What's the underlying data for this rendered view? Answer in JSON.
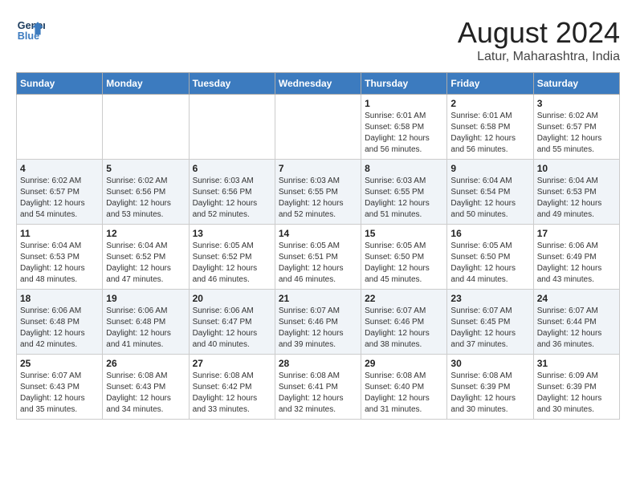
{
  "header": {
    "logo_line1": "General",
    "logo_line2": "Blue",
    "month_year": "August 2024",
    "location": "Latur, Maharashtra, India"
  },
  "days_of_week": [
    "Sunday",
    "Monday",
    "Tuesday",
    "Wednesday",
    "Thursday",
    "Friday",
    "Saturday"
  ],
  "weeks": [
    [
      {
        "day": "",
        "info": ""
      },
      {
        "day": "",
        "info": ""
      },
      {
        "day": "",
        "info": ""
      },
      {
        "day": "",
        "info": ""
      },
      {
        "day": "1",
        "info": "Sunrise: 6:01 AM\nSunset: 6:58 PM\nDaylight: 12 hours\nand 56 minutes."
      },
      {
        "day": "2",
        "info": "Sunrise: 6:01 AM\nSunset: 6:58 PM\nDaylight: 12 hours\nand 56 minutes."
      },
      {
        "day": "3",
        "info": "Sunrise: 6:02 AM\nSunset: 6:57 PM\nDaylight: 12 hours\nand 55 minutes."
      }
    ],
    [
      {
        "day": "4",
        "info": "Sunrise: 6:02 AM\nSunset: 6:57 PM\nDaylight: 12 hours\nand 54 minutes."
      },
      {
        "day": "5",
        "info": "Sunrise: 6:02 AM\nSunset: 6:56 PM\nDaylight: 12 hours\nand 53 minutes."
      },
      {
        "day": "6",
        "info": "Sunrise: 6:03 AM\nSunset: 6:56 PM\nDaylight: 12 hours\nand 52 minutes."
      },
      {
        "day": "7",
        "info": "Sunrise: 6:03 AM\nSunset: 6:55 PM\nDaylight: 12 hours\nand 52 minutes."
      },
      {
        "day": "8",
        "info": "Sunrise: 6:03 AM\nSunset: 6:55 PM\nDaylight: 12 hours\nand 51 minutes."
      },
      {
        "day": "9",
        "info": "Sunrise: 6:04 AM\nSunset: 6:54 PM\nDaylight: 12 hours\nand 50 minutes."
      },
      {
        "day": "10",
        "info": "Sunrise: 6:04 AM\nSunset: 6:53 PM\nDaylight: 12 hours\nand 49 minutes."
      }
    ],
    [
      {
        "day": "11",
        "info": "Sunrise: 6:04 AM\nSunset: 6:53 PM\nDaylight: 12 hours\nand 48 minutes."
      },
      {
        "day": "12",
        "info": "Sunrise: 6:04 AM\nSunset: 6:52 PM\nDaylight: 12 hours\nand 47 minutes."
      },
      {
        "day": "13",
        "info": "Sunrise: 6:05 AM\nSunset: 6:52 PM\nDaylight: 12 hours\nand 46 minutes."
      },
      {
        "day": "14",
        "info": "Sunrise: 6:05 AM\nSunset: 6:51 PM\nDaylight: 12 hours\nand 46 minutes."
      },
      {
        "day": "15",
        "info": "Sunrise: 6:05 AM\nSunset: 6:50 PM\nDaylight: 12 hours\nand 45 minutes."
      },
      {
        "day": "16",
        "info": "Sunrise: 6:05 AM\nSunset: 6:50 PM\nDaylight: 12 hours\nand 44 minutes."
      },
      {
        "day": "17",
        "info": "Sunrise: 6:06 AM\nSunset: 6:49 PM\nDaylight: 12 hours\nand 43 minutes."
      }
    ],
    [
      {
        "day": "18",
        "info": "Sunrise: 6:06 AM\nSunset: 6:48 PM\nDaylight: 12 hours\nand 42 minutes."
      },
      {
        "day": "19",
        "info": "Sunrise: 6:06 AM\nSunset: 6:48 PM\nDaylight: 12 hours\nand 41 minutes."
      },
      {
        "day": "20",
        "info": "Sunrise: 6:06 AM\nSunset: 6:47 PM\nDaylight: 12 hours\nand 40 minutes."
      },
      {
        "day": "21",
        "info": "Sunrise: 6:07 AM\nSunset: 6:46 PM\nDaylight: 12 hours\nand 39 minutes."
      },
      {
        "day": "22",
        "info": "Sunrise: 6:07 AM\nSunset: 6:46 PM\nDaylight: 12 hours\nand 38 minutes."
      },
      {
        "day": "23",
        "info": "Sunrise: 6:07 AM\nSunset: 6:45 PM\nDaylight: 12 hours\nand 37 minutes."
      },
      {
        "day": "24",
        "info": "Sunrise: 6:07 AM\nSunset: 6:44 PM\nDaylight: 12 hours\nand 36 minutes."
      }
    ],
    [
      {
        "day": "25",
        "info": "Sunrise: 6:07 AM\nSunset: 6:43 PM\nDaylight: 12 hours\nand 35 minutes."
      },
      {
        "day": "26",
        "info": "Sunrise: 6:08 AM\nSunset: 6:43 PM\nDaylight: 12 hours\nand 34 minutes."
      },
      {
        "day": "27",
        "info": "Sunrise: 6:08 AM\nSunset: 6:42 PM\nDaylight: 12 hours\nand 33 minutes."
      },
      {
        "day": "28",
        "info": "Sunrise: 6:08 AM\nSunset: 6:41 PM\nDaylight: 12 hours\nand 32 minutes."
      },
      {
        "day": "29",
        "info": "Sunrise: 6:08 AM\nSunset: 6:40 PM\nDaylight: 12 hours\nand 31 minutes."
      },
      {
        "day": "30",
        "info": "Sunrise: 6:08 AM\nSunset: 6:39 PM\nDaylight: 12 hours\nand 30 minutes."
      },
      {
        "day": "31",
        "info": "Sunrise: 6:09 AM\nSunset: 6:39 PM\nDaylight: 12 hours\nand 30 minutes."
      }
    ]
  ]
}
